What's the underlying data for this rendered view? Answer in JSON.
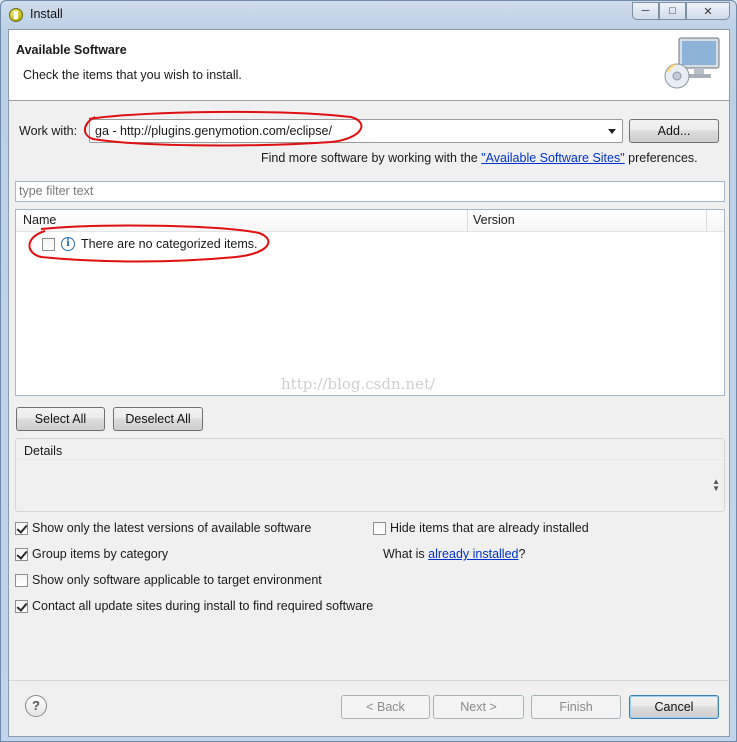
{
  "window": {
    "title": "Install",
    "minimize": "─",
    "maximize": "□",
    "close": "✕"
  },
  "header": {
    "title": "Available Software",
    "subtitle": "Check the items that you wish to install."
  },
  "work_with": {
    "label": "Work with:",
    "value": "ga - http://plugins.genymotion.com/eclipse/",
    "add_label": "Add..."
  },
  "find_more": {
    "prefix": "Find more software by working with the ",
    "link": "\"Available Software Sites\"",
    "suffix": " preferences."
  },
  "filter": {
    "placeholder": "type filter text"
  },
  "tree": {
    "columns": [
      "Name",
      "Version"
    ],
    "rows": [
      {
        "label": "There are no categorized items.",
        "checked": false,
        "icon": "info-icon"
      }
    ]
  },
  "watermark": "http://blog.csdn.net/",
  "selection": {
    "select_all": "Select All",
    "deselect_all": "Deselect All"
  },
  "details": {
    "label": "Details"
  },
  "options": {
    "latest_versions": "Show only the latest versions of available software",
    "hide_installed": "Hide items that are already installed",
    "group_by_category": "Group items by category",
    "what_is_prefix": "What is ",
    "what_is_link": "already installed",
    "what_is_suffix": "?",
    "target_env": "Show only software applicable to target environment",
    "contact_sites": "Contact all update sites during install to find required software"
  },
  "footer": {
    "help": "?",
    "back": "< Back",
    "next": "Next >",
    "finish": "Finish",
    "cancel": "Cancel"
  },
  "colors": {
    "annotation": "#e01010",
    "link": "#0033cc",
    "accent": "#3c7fb1"
  }
}
